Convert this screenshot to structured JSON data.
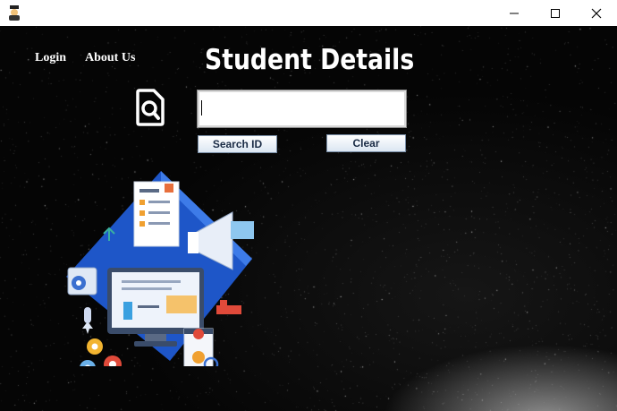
{
  "window": {
    "controls": [
      "minimize-icon",
      "maximize-icon",
      "close-icon"
    ]
  },
  "nav": {
    "login": "Login",
    "about": "About Us"
  },
  "header": {
    "title": "Student Details"
  },
  "search": {
    "value": "",
    "search_button": "Search ID",
    "clear_button": "Clear"
  },
  "icons": {
    "search_doc": "document-search-icon",
    "illustration": "education-illustration"
  },
  "colors": {
    "background": "#050505",
    "text": "#ffffff",
    "button_text": "#1a2b45"
  }
}
